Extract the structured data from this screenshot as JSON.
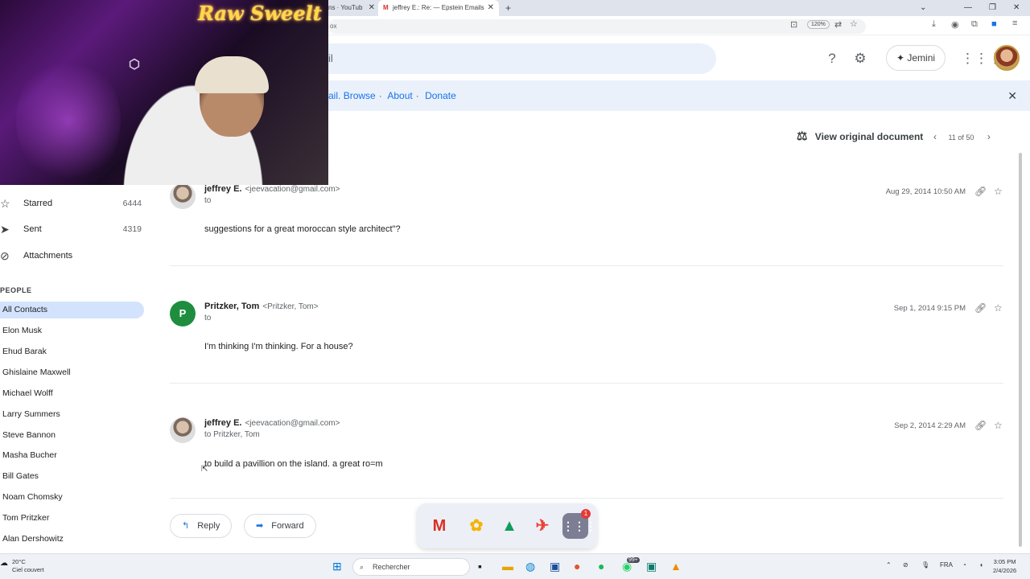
{
  "browser": {
    "tabs": [
      {
        "label": "ns · YouTub",
        "active": false
      },
      {
        "label": "jeffrey E.: Re: — Epstein Emails",
        "active": true
      }
    ],
    "new_tab": "+",
    "url_fragment": "ox",
    "zoom": "120%"
  },
  "header": {
    "search_fragment": "il",
    "jemini_label": "Jemini",
    "help_icon": "help-icon",
    "settings_icon": "gear-icon"
  },
  "banner": {
    "lead": "ail.",
    "links": [
      "Browse",
      "About",
      "Donate"
    ],
    "close": "✕"
  },
  "toolbar": {
    "view_original": "View original document",
    "pager": "11 of 50"
  },
  "sidebar": {
    "items": [
      {
        "label": "Starred",
        "count": "6444",
        "icon": "star-icon"
      },
      {
        "label": "Sent",
        "count": "4319",
        "icon": "send-icon"
      },
      {
        "label": "Attachments",
        "count": "",
        "icon": "paperclip-icon"
      }
    ],
    "people_heading": "PEOPLE",
    "contacts": [
      "All Contacts",
      "Elon Musk",
      "Ehud Barak",
      "Ghislaine Maxwell",
      "Michael Wolff",
      "Larry Summers",
      "Steve Bannon",
      "Masha Bucher",
      "Bill Gates",
      "Noam Chomsky",
      "Tom Pritzker",
      "Alan Dershowitz"
    ],
    "selected_contact": "All Contacts"
  },
  "messages": [
    {
      "sender": "jeffrey E.",
      "email": "<jeevacation@gmail.com>",
      "to": "to",
      "date": "Aug 29, 2014 10:50 AM",
      "body": "suggestions for a great moroccan style architect\"?",
      "avatar": "photo"
    },
    {
      "sender": "Pritzker, Tom",
      "email": "<Pritzker, Tom>",
      "to": "to",
      "date": "Sep 1, 2014 9:15 PM",
      "body": "I'm thinking I'm thinking. For a house?",
      "avatar": "P"
    },
    {
      "sender": "jeffrey E.",
      "email": "<jeevacation@gmail.com>",
      "to": "to Pritzker, Tom",
      "date": "Sep 2, 2014 2:29 AM",
      "body": "to build a pavillion on the island. a great ro=m",
      "avatar": "photo"
    }
  ],
  "actions": {
    "reply": "Reply",
    "forward": "Forward"
  },
  "webcam": {
    "neon_sign": "Raw Sweelt"
  },
  "dock": {
    "badge": "1"
  },
  "taskbar": {
    "search_placeholder": "Rechercher",
    "weather_temp": "20°C",
    "weather_desc": "Ciel couvert",
    "lang": "FRA",
    "time": "3:05 PM",
    "date": "2/4/2026",
    "whatsapp_badge": "99+"
  }
}
